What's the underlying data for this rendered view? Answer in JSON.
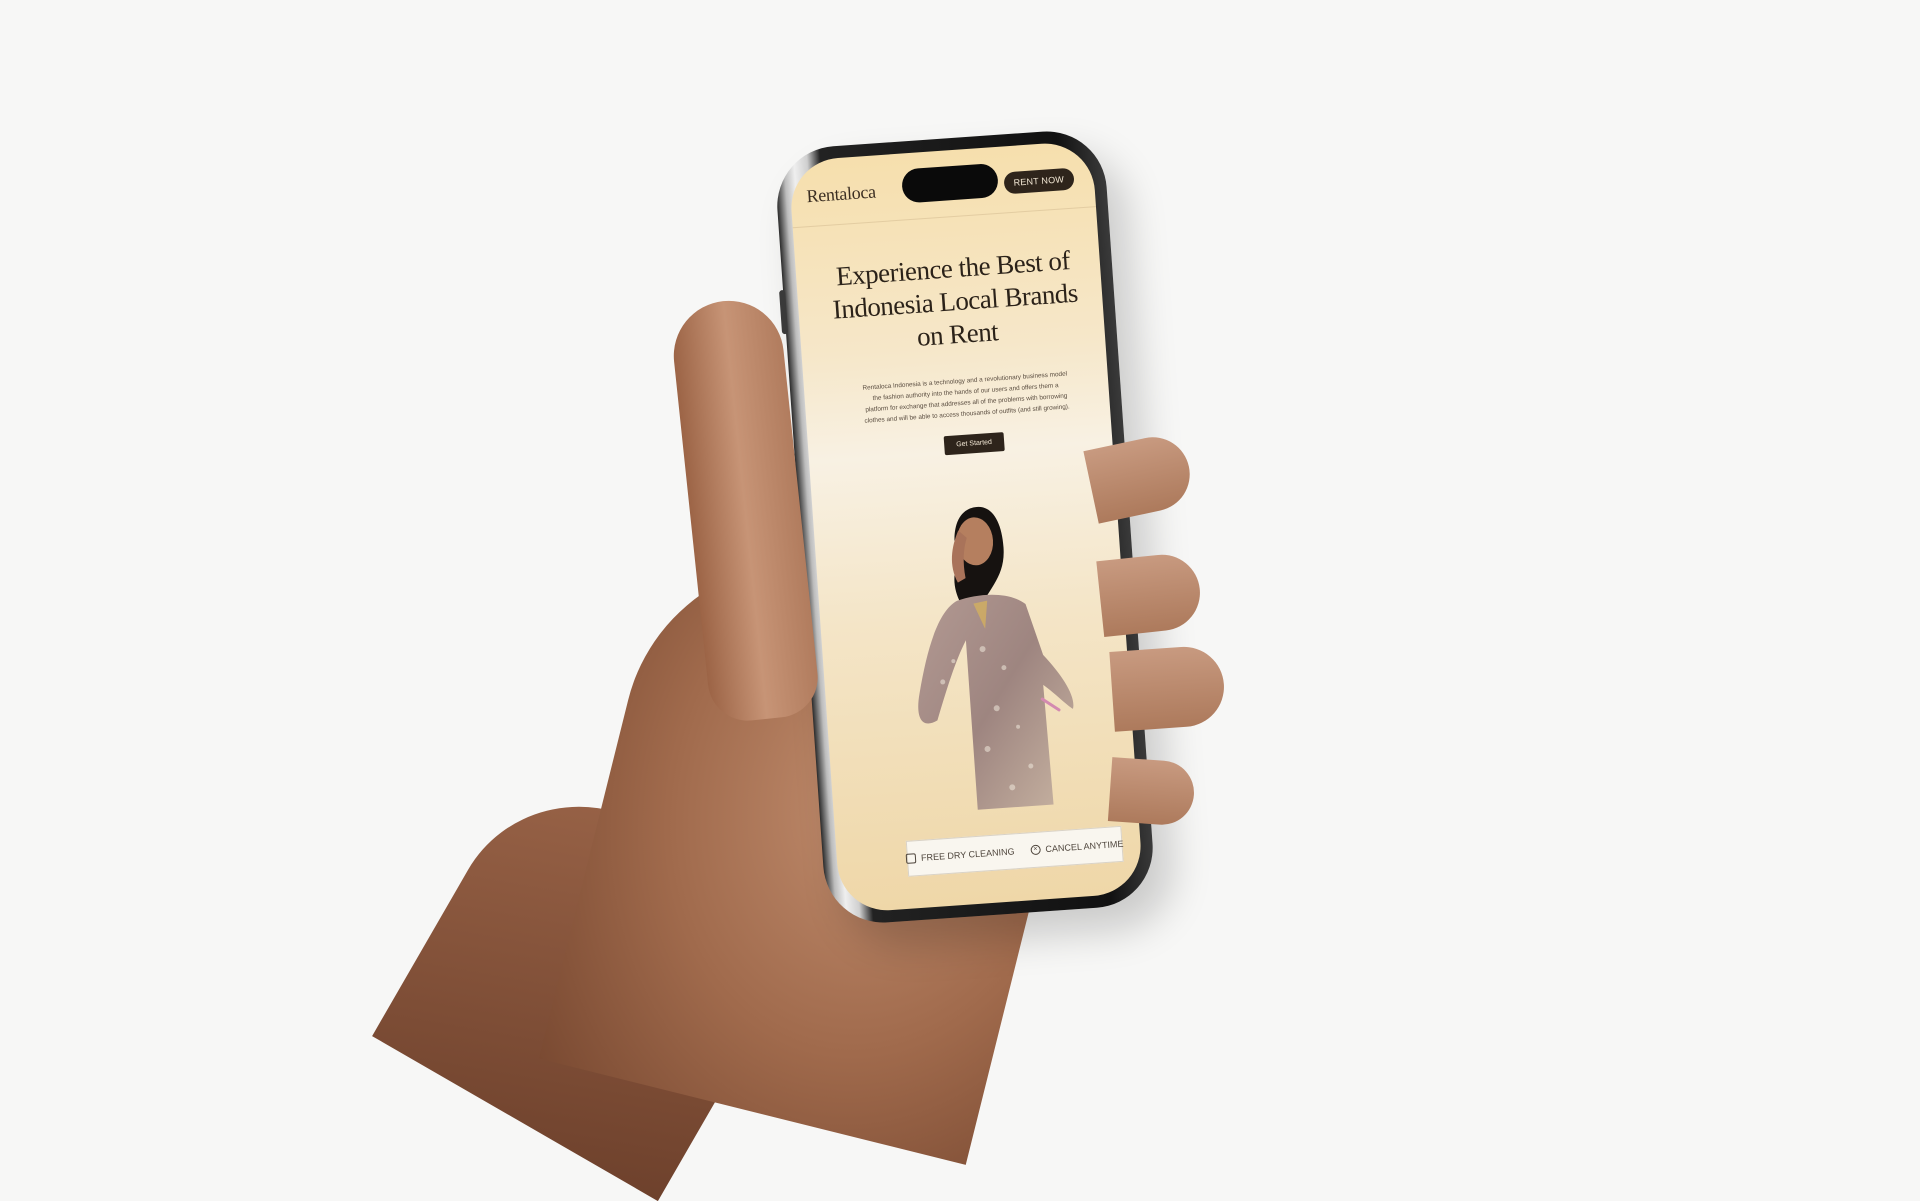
{
  "app": {
    "logo": "Rentaloca",
    "nav_button": "RENT NOW"
  },
  "hero": {
    "title": "Experience the Best of Indonesia Local Brands on Rent",
    "description": "Rentaloca Indonesia is a technology and a revolutionary business model the fashion authority into the hands of our users and offers them a platform for exchange that addresses all of the problems with borrowing clothes and will be able to access thousands of outfits (and still growing).",
    "cta": "Get Started"
  },
  "features": [
    {
      "label": "FREE DRY CLEANING",
      "icon": "dry-cleaning-icon"
    },
    {
      "label": "CANCEL ANYTIME",
      "icon": "cancel-circle-icon"
    }
  ],
  "colors": {
    "accent_dark": "#2e241b",
    "gradient_gold": "#f6dfad",
    "text_dark": "#2b2219"
  }
}
